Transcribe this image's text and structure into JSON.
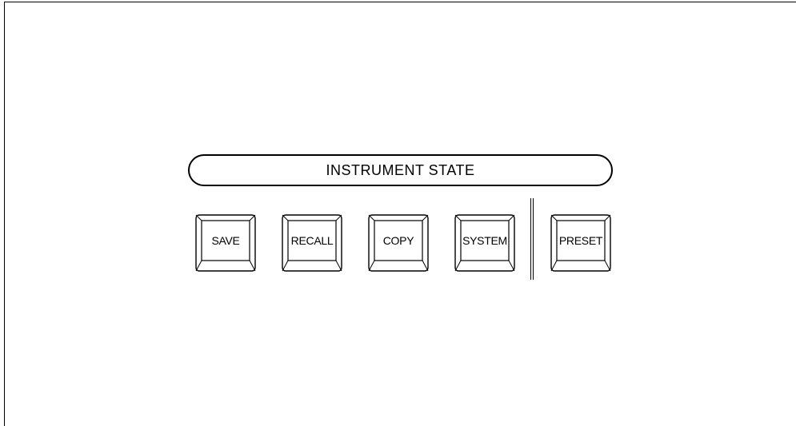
{
  "panel": {
    "group_title": "INSTRUMENT STATE",
    "keys": [
      {
        "label": "SAVE"
      },
      {
        "label": "RECALL"
      },
      {
        "label": "COPY"
      },
      {
        "label": "SYSTEM"
      },
      {
        "label": "PRESET"
      }
    ]
  }
}
